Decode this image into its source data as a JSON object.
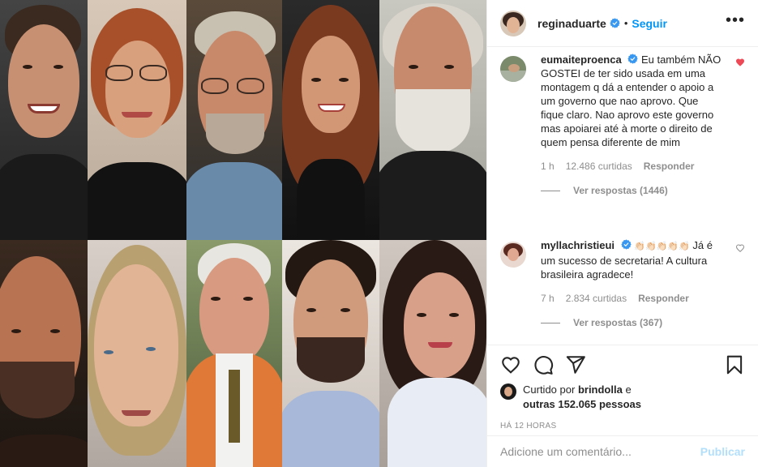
{
  "post": {
    "username": "reginaduarte",
    "follow_label": "Seguir",
    "separator": "•",
    "more_label": "•••"
  },
  "comments": [
    {
      "username": "eumaiteproenca",
      "text": "Eu também NÃO GOSTEI de ter sido usada em uma montagem q dá a entender o apoio a um governo que nao aprovo. Que fique claro. Nao aprovo este governo mas apoiarei até à morte o direito de quem pensa diferente de mim",
      "time": "1 h",
      "likes": "12.486 curtidas",
      "reply_label": "Responder",
      "view_replies": "Ver respostas (1446)",
      "liked": true
    },
    {
      "username": "myllachristieui",
      "emoji": "👏🏻👏🏻👏🏻👏🏻👏🏻",
      "text": "Já é um sucesso de secretaria! A cultura brasileira agradece!",
      "time": "7 h",
      "likes": "2.834 curtidas",
      "reply_label": "Responder",
      "view_replies": "Ver respostas (367)",
      "liked": false
    }
  ],
  "likes_line": {
    "prefix": "Curtido por",
    "user": "brindolla",
    "connector": "e",
    "others": "outras 152.065 pessoas"
  },
  "time_ago": "HÁ 12 HORAS",
  "add_comment": {
    "placeholder": "Adicione um comentário...",
    "publish_label": "Publicar"
  },
  "colors": {
    "accent": "#0095f6",
    "like_red": "#ed4956",
    "muted": "#8e8e8e",
    "publish_disabled": "#b2dffc"
  }
}
